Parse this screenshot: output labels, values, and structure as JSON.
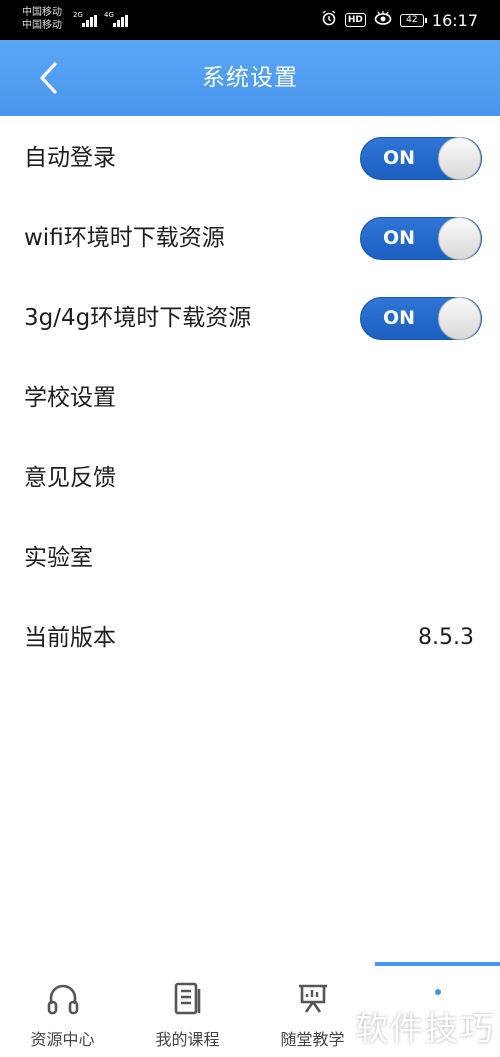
{
  "status_bar": {
    "carrier_1": "中国移动",
    "carrier_2": "中国移动",
    "network_1": "2G",
    "network_2": "4G",
    "battery": "42",
    "time": "16:17",
    "icons": [
      "alarm-icon",
      "hd-icon",
      "eye-icon",
      "battery-icon"
    ]
  },
  "header": {
    "title": "系统设置",
    "back_icon": "chevron-left-icon",
    "color": "#4a96ee"
  },
  "settings": [
    {
      "label": "自动登录",
      "toggle": "ON"
    },
    {
      "label": "wifi环境时下载资源",
      "toggle": "ON"
    },
    {
      "label": "3g/4g环境时下载资源",
      "toggle": "ON"
    },
    {
      "label": "学校设置"
    },
    {
      "label": "意见反馈"
    },
    {
      "label": "实验室"
    },
    {
      "label": "当前版本",
      "value": "8.5.3"
    }
  ],
  "tabbar": {
    "tabs": [
      {
        "label": "资源中心",
        "icon": "headphones-icon"
      },
      {
        "label": "我的课程",
        "icon": "document-icon"
      },
      {
        "label": "随堂教学",
        "icon": "presentation-icon"
      }
    ],
    "active_index": 3
  },
  "watermark": "软件技巧"
}
